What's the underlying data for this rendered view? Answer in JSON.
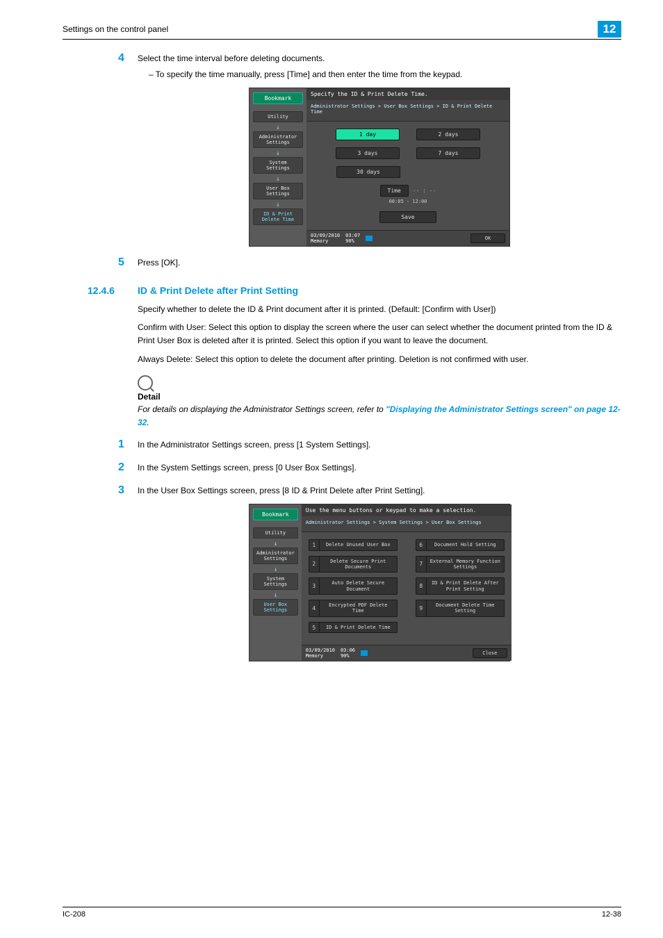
{
  "header": {
    "breadcrumb": "Settings on the control panel",
    "chapter": "12"
  },
  "footer": {
    "left": "IC-208",
    "right": "12-38"
  },
  "step4": {
    "num": "4",
    "text": "Select the time interval before deleting documents.",
    "sub": "–   To specify the time manually, press [Time] and then enter the time from the keypad."
  },
  "shot1": {
    "bookmark": "Bookmark",
    "crumbs": [
      "Utility",
      "Administrator Settings",
      "System Settings",
      "User Box Settings",
      "ID & Print Delete Time"
    ],
    "title": "Specify the ID & Print Delete Time.",
    "bread": "Administrator Settings > User Box Settings > ID & Print Delete Time",
    "opts": [
      "1 day",
      "2 days",
      "3 days",
      "7 days",
      "30 days"
    ],
    "time_label": "Time",
    "time_blank": "-- : --",
    "time_range": "00:05  -  12:00",
    "save": "Save",
    "status_date": "03/09/2010",
    "status_time": "03:07",
    "status_mem": "Memory",
    "status_memv": "90%",
    "ok": "OK"
  },
  "step5": {
    "num": "5",
    "text": "Press [OK]."
  },
  "sec": {
    "num": "12.4.6",
    "title": "ID & Print Delete after Print Setting",
    "p1": "Specify whether to delete the ID & Print document after it is printed. (Default: [Confirm with User])",
    "p2": "Confirm with User: Select this option to display the screen where the user can select whether the document printed from the ID & Print User Box is deleted after it is printed. Select this option if you want to leave the document.",
    "p3": "Always Delete: Select this option to delete the document after printing. Deletion is not confirmed with user.",
    "detail_label": "Detail",
    "detail_text": "For details on displaying the Administrator Settings screen, refer to ",
    "detail_link": "\"Displaying the Administrator Settings screen\" on page 12-32",
    "detail_tail": "."
  },
  "steps": {
    "s1": {
      "num": "1",
      "text": "In the Administrator Settings screen, press [1 System Settings]."
    },
    "s2": {
      "num": "2",
      "text": "In the System Settings screen, press [0 User Box Settings]."
    },
    "s3": {
      "num": "3",
      "text": "In the User Box Settings screen, press [8 ID & Print Delete after Print Setting]."
    }
  },
  "shot2": {
    "bookmark": "Bookmark",
    "crumbs": [
      "Utility",
      "Administrator Settings",
      "System Settings",
      "User Box Settings"
    ],
    "title": "Use the menu buttons or keypad to make a selection.",
    "bread": "Administrator Settings > System Settings > User Box Settings",
    "items": [
      {
        "n": "1",
        "t": "Delete Unused User Box"
      },
      {
        "n": "2",
        "t": "Delete Secure Print Documents"
      },
      {
        "n": "3",
        "t": "Auto Delete Secure Document"
      },
      {
        "n": "4",
        "t": "Encrypted PDF Delete Time"
      },
      {
        "n": "5",
        "t": "ID & Print Delete Time"
      },
      {
        "n": "6",
        "t": "Document Hold Setting"
      },
      {
        "n": "7",
        "t": "External Memory Function Settings"
      },
      {
        "n": "8",
        "t": "ID & Print Delete After Print Setting"
      },
      {
        "n": "9",
        "t": "Document Delete Time Setting"
      }
    ],
    "status_date": "03/09/2010",
    "status_time": "03:06",
    "status_mem": "Memory",
    "status_memv": "90%",
    "close": "Close"
  }
}
